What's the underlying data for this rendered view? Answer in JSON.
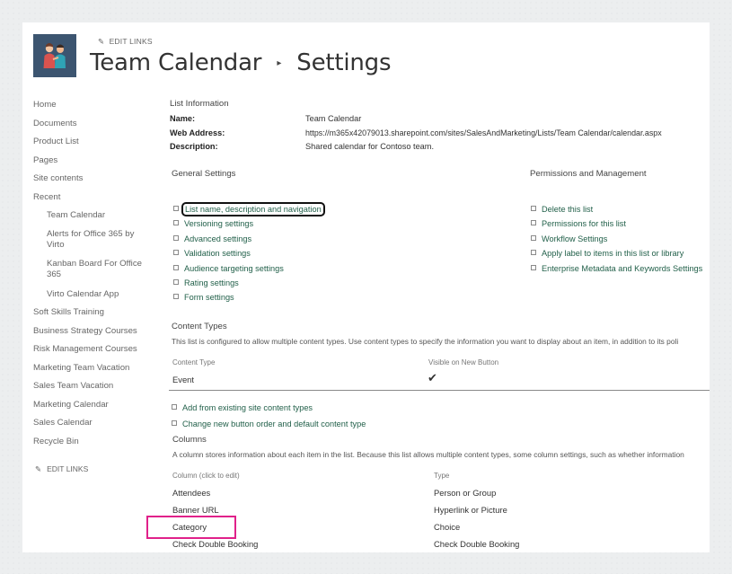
{
  "header": {
    "edit_links": "EDIT LINKS",
    "title": "Team Calendar",
    "subtitle": "Settings"
  },
  "nav": {
    "items": [
      "Home",
      "Documents",
      "Product List",
      "Pages",
      "Site contents",
      "Recent"
    ],
    "recent": [
      "Team Calendar",
      "Alerts for Office 365 by Virto",
      "Kanban Board For Office 365",
      "Virto Calendar App"
    ],
    "more": [
      "Soft Skills Training",
      "Business Strategy Courses",
      "Risk Management Courses",
      "Marketing Team Vacation",
      "Sales Team Vacation",
      "Marketing Calendar",
      "Sales Calendar",
      "Recycle Bin"
    ],
    "edit_links": "EDIT LINKS"
  },
  "list_info": {
    "heading": "List Information",
    "name_label": "Name:",
    "name": "Team Calendar",
    "web_label": "Web Address:",
    "web": "https://m365x42079013.sharepoint.com/sites/SalesAndMarketing/Lists/Team Calendar/calendar.aspx",
    "desc_label": "Description:",
    "desc": "Shared calendar for Contoso team."
  },
  "general": {
    "heading": "General Settings",
    "links": [
      "List name, description and navigation",
      "Versioning settings",
      "Advanced settings",
      "Validation settings",
      "Audience targeting settings",
      "Rating settings",
      "Form settings"
    ]
  },
  "permissions": {
    "heading": "Permissions and Management",
    "links": [
      "Delete this list",
      "Permissions for this list",
      "Workflow Settings",
      "Apply label to items in this list or library",
      "Enterprise Metadata and Keywords Settings"
    ]
  },
  "content_types": {
    "heading": "Content Types",
    "description": "This list is configured to allow multiple content types. Use content types to specify the information you want to display about an item, in addition to its poli",
    "col_type": "Content Type",
    "col_visible": "Visible on New Button",
    "row_name": "Event",
    "row_visible": "✔",
    "links": [
      "Add from existing site content types",
      "Change new button order and default content type"
    ]
  },
  "columns": {
    "heading": "Columns",
    "description": "A column stores information about each item in the list. Because this list allows multiple content types, some column settings, such as whether information",
    "col_name": "Column (click to edit)",
    "col_type": "Type",
    "rows": [
      {
        "name": "Attendees",
        "type": "Person or Group"
      },
      {
        "name": "Banner URL",
        "type": "Hyperlink or Picture"
      },
      {
        "name": "Category",
        "type": "Choice"
      },
      {
        "name": "Check Double Booking",
        "type": "Check Double Booking"
      }
    ]
  },
  "colors": {
    "link": "#22604a",
    "highlight": "#e0218a",
    "logo_bg": "#3c5570"
  }
}
